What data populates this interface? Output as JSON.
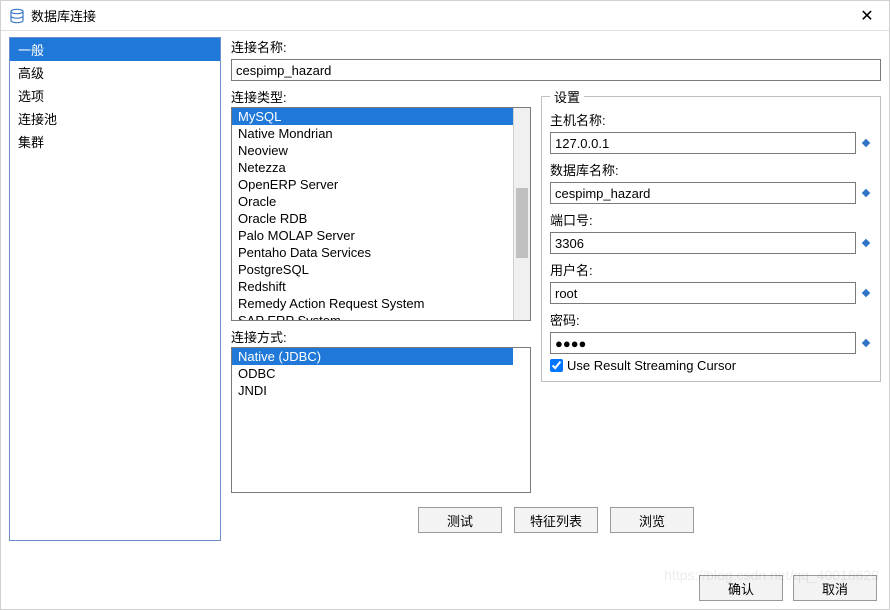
{
  "window": {
    "title": "数据库连接"
  },
  "sidebar": {
    "items": [
      {
        "label": "一般",
        "selected": true
      },
      {
        "label": "高级"
      },
      {
        "label": "选项"
      },
      {
        "label": "连接池"
      },
      {
        "label": "集群"
      }
    ]
  },
  "labels": {
    "conn_name": "连接名称:",
    "conn_type": "连接类型:",
    "access": "连接方式:",
    "settings": "设置",
    "host": "主机名称:",
    "db": "数据库名称:",
    "port": "端口号:",
    "user": "用户名:",
    "pass": "密码:",
    "cursor": "Use Result Streaming Cursor"
  },
  "values": {
    "conn_name": "cespimp_hazard",
    "host": "127.0.0.1",
    "db": "cespimp_hazard",
    "port": "3306",
    "user": "root",
    "pass": "●●●●",
    "cursor_checked": true
  },
  "conn_types": [
    {
      "label": "MySQL",
      "selected": true
    },
    {
      "label": "Native Mondrian"
    },
    {
      "label": "Neoview"
    },
    {
      "label": "Netezza"
    },
    {
      "label": "OpenERP Server"
    },
    {
      "label": "Oracle"
    },
    {
      "label": "Oracle RDB"
    },
    {
      "label": "Palo MOLAP Server"
    },
    {
      "label": "Pentaho Data Services"
    },
    {
      "label": "PostgreSQL"
    },
    {
      "label": "Redshift"
    },
    {
      "label": "Remedy Action Request System"
    },
    {
      "label": "SAP ERP System"
    }
  ],
  "access_methods": [
    {
      "label": "Native (JDBC)",
      "selected": true
    },
    {
      "label": "ODBC"
    },
    {
      "label": "JNDI"
    }
  ],
  "buttons": {
    "test": "测试",
    "features": "特征列表",
    "browse": "浏览",
    "ok": "确认",
    "cancel": "取消"
  },
  "watermark": "https://blog.csdn.net/qq_40018629",
  "colors": {
    "accent": "#2079d8",
    "diamond": "#2f73c7"
  }
}
